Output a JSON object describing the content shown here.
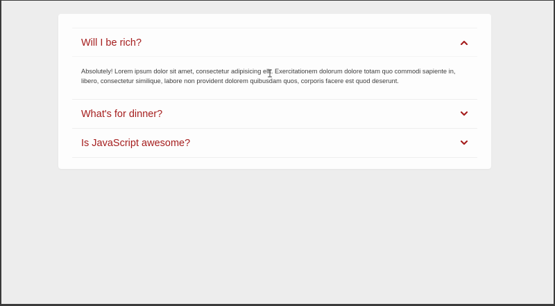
{
  "faq": {
    "items": [
      {
        "question": "Will I be rich?",
        "answer": "Absolutely! Lorem ipsum dolor sit amet, consectetur adipisicing elit. Exercitationem dolorum dolore totam quo commodi sapiente in, libero, consectetur similique, labore non provident dolorem quibusdam quos, corporis facere est quod deserunt.",
        "expanded": true,
        "icon": "chevron-up-icon"
      },
      {
        "question": "What's for dinner?",
        "expanded": false,
        "icon": "chevron-down-icon"
      },
      {
        "question": "Is JavaScript awesome?",
        "expanded": false,
        "icon": "chevron-down-icon"
      }
    ]
  },
  "colors": {
    "accent": "#a51d1d",
    "page_background": "#ededed",
    "card_background": "#fdfdfd",
    "answer_text": "#3d3d3d"
  }
}
